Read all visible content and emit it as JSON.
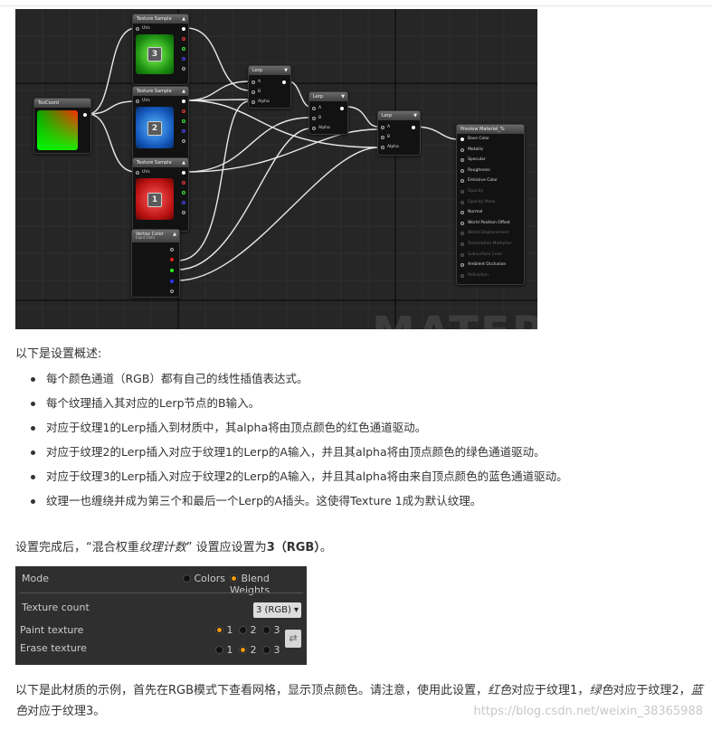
{
  "graph": {
    "nodes": {
      "texcoord": {
        "title": "TexCoord"
      },
      "tex3": {
        "title": "Texture Sample",
        "pins": [
          "UVs"
        ],
        "number": "3"
      },
      "tex2": {
        "title": "Texture Sample",
        "pins": [
          "UVs"
        ],
        "number": "2"
      },
      "tex1": {
        "title": "Texture Sample",
        "pins": [
          "UVs"
        ],
        "number": "1"
      },
      "vertexcolor": {
        "title": "Vertex Color",
        "subtitle": "Input Data"
      },
      "lerp1": {
        "title": "Lerp",
        "pins": [
          "A",
          "B",
          "Alpha"
        ]
      },
      "lerp2": {
        "title": "Lerp",
        "pins": [
          "A",
          "B",
          "Alpha"
        ]
      },
      "lerp3": {
        "title": "Lerp",
        "pins": [
          "A",
          "B",
          "Alpha"
        ]
      },
      "preview": {
        "title": "Preview Material_%",
        "pins": [
          {
            "label": "Base Color",
            "active": true
          },
          {
            "label": "Metallic",
            "active": true
          },
          {
            "label": "Specular",
            "active": true
          },
          {
            "label": "Roughness",
            "active": true
          },
          {
            "label": "Emissive Color",
            "active": true
          },
          {
            "label": "Opacity",
            "active": false
          },
          {
            "label": "Opacity Mask",
            "active": false
          },
          {
            "label": "Normal",
            "active": true
          },
          {
            "label": "World Position Offset",
            "active": true
          },
          {
            "label": "World Displacement",
            "active": false
          },
          {
            "label": "Tessellation Multiplier",
            "active": false
          },
          {
            "label": "Subsurface Color",
            "active": false
          },
          {
            "label": "Ambient Occlusion",
            "active": true
          },
          {
            "label": "Refraction",
            "active": false
          }
        ]
      }
    },
    "watermark": "MATERI"
  },
  "intro": "以下是设置概述:",
  "points": [
    "每个颜色通道（RGB）都有自己的线性插值表达式。",
    "每个纹理插入其对应的Lerp节点的B输入。",
    "对应于纹理1的Lerp插入到材质中，其alpha将由顶点颜色的红色通道驱动。",
    "对应于纹理2的Lerp插入对应于纹理1的Lerp的A输入，并且其alpha将由顶点颜色的绿色通道驱动。",
    "对应于纹理3的Lerp插入对应于纹理2的Lerp的A输入，并且其alpha将由来自顶点颜色的蓝色通道驱动。",
    "纹理一也缠绕并成为第三个和最后一个Lerp的A插头。这使得Texture 1成为默认纹理。"
  ],
  "setting": {
    "prefix": "设置完成后，",
    "quote_open": "“混合权重",
    "quote_italic": "纹理计数",
    "quote_close": "”",
    "middle": "设置应设置为",
    "value": "3（RGB）",
    "suffix": "。"
  },
  "panel": {
    "mode_label": "Mode",
    "mode_options": [
      {
        "label": "Colors",
        "selected": false
      },
      {
        "label": "Blend Weights",
        "selected": true
      }
    ],
    "texture_count_label": "Texture count",
    "texture_count_value": "3 (RGB)",
    "paint_label": "Paint texture",
    "paint_options": [
      {
        "label": "1",
        "selected": true
      },
      {
        "label": "2",
        "selected": false
      },
      {
        "label": "3",
        "selected": false
      }
    ],
    "erase_label": "Erase texture",
    "erase_options": [
      {
        "label": "1",
        "selected": false
      },
      {
        "label": "2",
        "selected": true
      },
      {
        "label": "3",
        "selected": false
      }
    ]
  },
  "example": {
    "part1": "以下是此材质的示例，首先在RGB模式下查看网格，显示顶点颜色。请注意，使用此设置，",
    "red": "红色",
    "part2": "对应于纹理1，",
    "green": "绿色",
    "part3": "对应于纹理2，",
    "blue": "蓝色",
    "part4": "对应于纹理3。"
  },
  "site_watermark": "https://blog.csdn.net/weixin_38365988",
  "colors": {
    "accent": "#f39c12",
    "graph_bg": "#262626",
    "panel_bg": "#2f2f2f"
  }
}
